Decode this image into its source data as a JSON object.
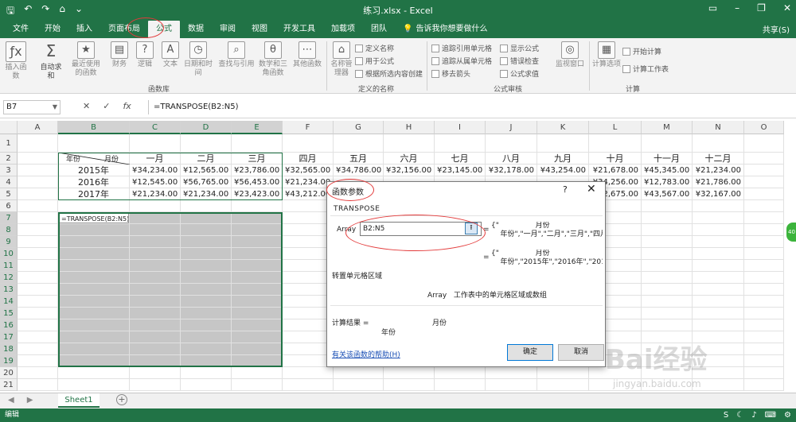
{
  "window": {
    "title": "练习.xlsx - Excel",
    "share": "共享(S)"
  },
  "tabs": [
    "文件",
    "开始",
    "插入",
    "页面布局",
    "公式",
    "数据",
    "审阅",
    "视图",
    "开发工具",
    "加载项",
    "团队"
  ],
  "active_tab": "公式",
  "tell_me": "告诉我你想要做什么",
  "ribbon": {
    "insert_function": "插入函数",
    "autosum": "自动求和",
    "recent": "最近使用的函数",
    "financial": "财务",
    "logical": "逻辑",
    "text": "文本",
    "datetime": "日期和时间",
    "lookup": "查找与引用",
    "math": "数学和三角函数",
    "other": "其他函数",
    "group_library": "函数库",
    "name_manager": "名称管理器",
    "define_name": "定义名称",
    "use_in_formula": "用于公式",
    "create_from_sel": "根据所选内容创建",
    "group_names": "定义的名称",
    "trace_precedents": "追踪引用单元格",
    "trace_dependents": "追踪从属单元格",
    "remove_arrows": "移去箭头",
    "show_formulas": "显示公式",
    "error_check": "错误检查",
    "evaluate": "公式求值",
    "watch": "监视窗口",
    "group_audit": "公式审核",
    "calc_options": "计算选项",
    "calc_now": "开始计算",
    "calc_sheet": "计算工作表",
    "group_calc": "计算"
  },
  "formula_bar": {
    "name_box": "B7",
    "formula": "=TRANSPOSE(B2:N5)"
  },
  "columns": [
    "A",
    "B",
    "C",
    "D",
    "E",
    "F",
    "G",
    "H",
    "I",
    "J",
    "K",
    "L",
    "M",
    "N",
    "O"
  ],
  "rows": [
    "1",
    "2",
    "3",
    "4",
    "5",
    "6",
    "7",
    "8",
    "9",
    "10",
    "11",
    "12",
    "13",
    "14",
    "15",
    "16",
    "17",
    "18",
    "19",
    "20",
    "21"
  ],
  "table": {
    "corner_top": "月份",
    "corner_bottom": "年份",
    "months": [
      "一月",
      "二月",
      "三月",
      "四月",
      "五月",
      "六月",
      "七月",
      "八月",
      "九月",
      "十月",
      "十一月",
      "十二月"
    ],
    "years": [
      "2015年",
      "2016年",
      "2017年"
    ],
    "values": [
      [
        "¥34,234.00",
        "¥12,565.00",
        "¥23,786.00",
        "¥32,565.00",
        "¥34,786.00",
        "¥32,156.00",
        "¥23,145.00",
        "¥32,178.00",
        "¥43,254.00",
        "¥21,678.00",
        "¥45,345.00",
        "¥21,234.00"
      ],
      [
        "¥12,545.00",
        "¥56,765.00",
        "¥56,453.00",
        "¥21,234.00",
        "",
        "",
        "",
        "",
        "",
        "¥34,256.00",
        "¥12,783.00",
        "¥21,786.00"
      ],
      [
        "¥21,234.00",
        "¥21,234.00",
        "¥23,423.00",
        "¥43,212.00",
        "",
        "",
        "",
        "",
        "",
        "¥32,675.00",
        "¥43,567.00",
        "¥32,167.00"
      ]
    ],
    "b7_formula": "=TRANSPOSE(B2:N5)"
  },
  "dialog": {
    "title": "函数参数",
    "help": "?",
    "close": "✕",
    "function_name": "TRANSPOSE",
    "arg_label": "Array",
    "arg_value": "B2:N5",
    "eq": "=",
    "preview1_line1": "{\"                月份",
    "preview1_line2": "    年份\",\"一月\",\"二月\",\"三月\",\"四月",
    "preview2_line1": "{\"                月份",
    "preview2_line2": "    年份\",\"2015年\",\"2016年\",\"201",
    "description": "转置单元格区域",
    "arg_desc_name": "Array",
    "arg_desc": "工作表中的单元格区域或数组",
    "result_label": "计算结果 =",
    "result_top": "月份",
    "result_bottom": "年份",
    "help_link": "有关该函数的帮助(H)",
    "ok": "确定",
    "cancel": "取消"
  },
  "sheet_tab": "Sheet1",
  "status_text": "编辑",
  "watermark": "Bai经验",
  "watermark_url": "jingyan.baidu.com",
  "colors": {
    "excel_green": "#217346",
    "annotation_red": "#e33a3a"
  }
}
